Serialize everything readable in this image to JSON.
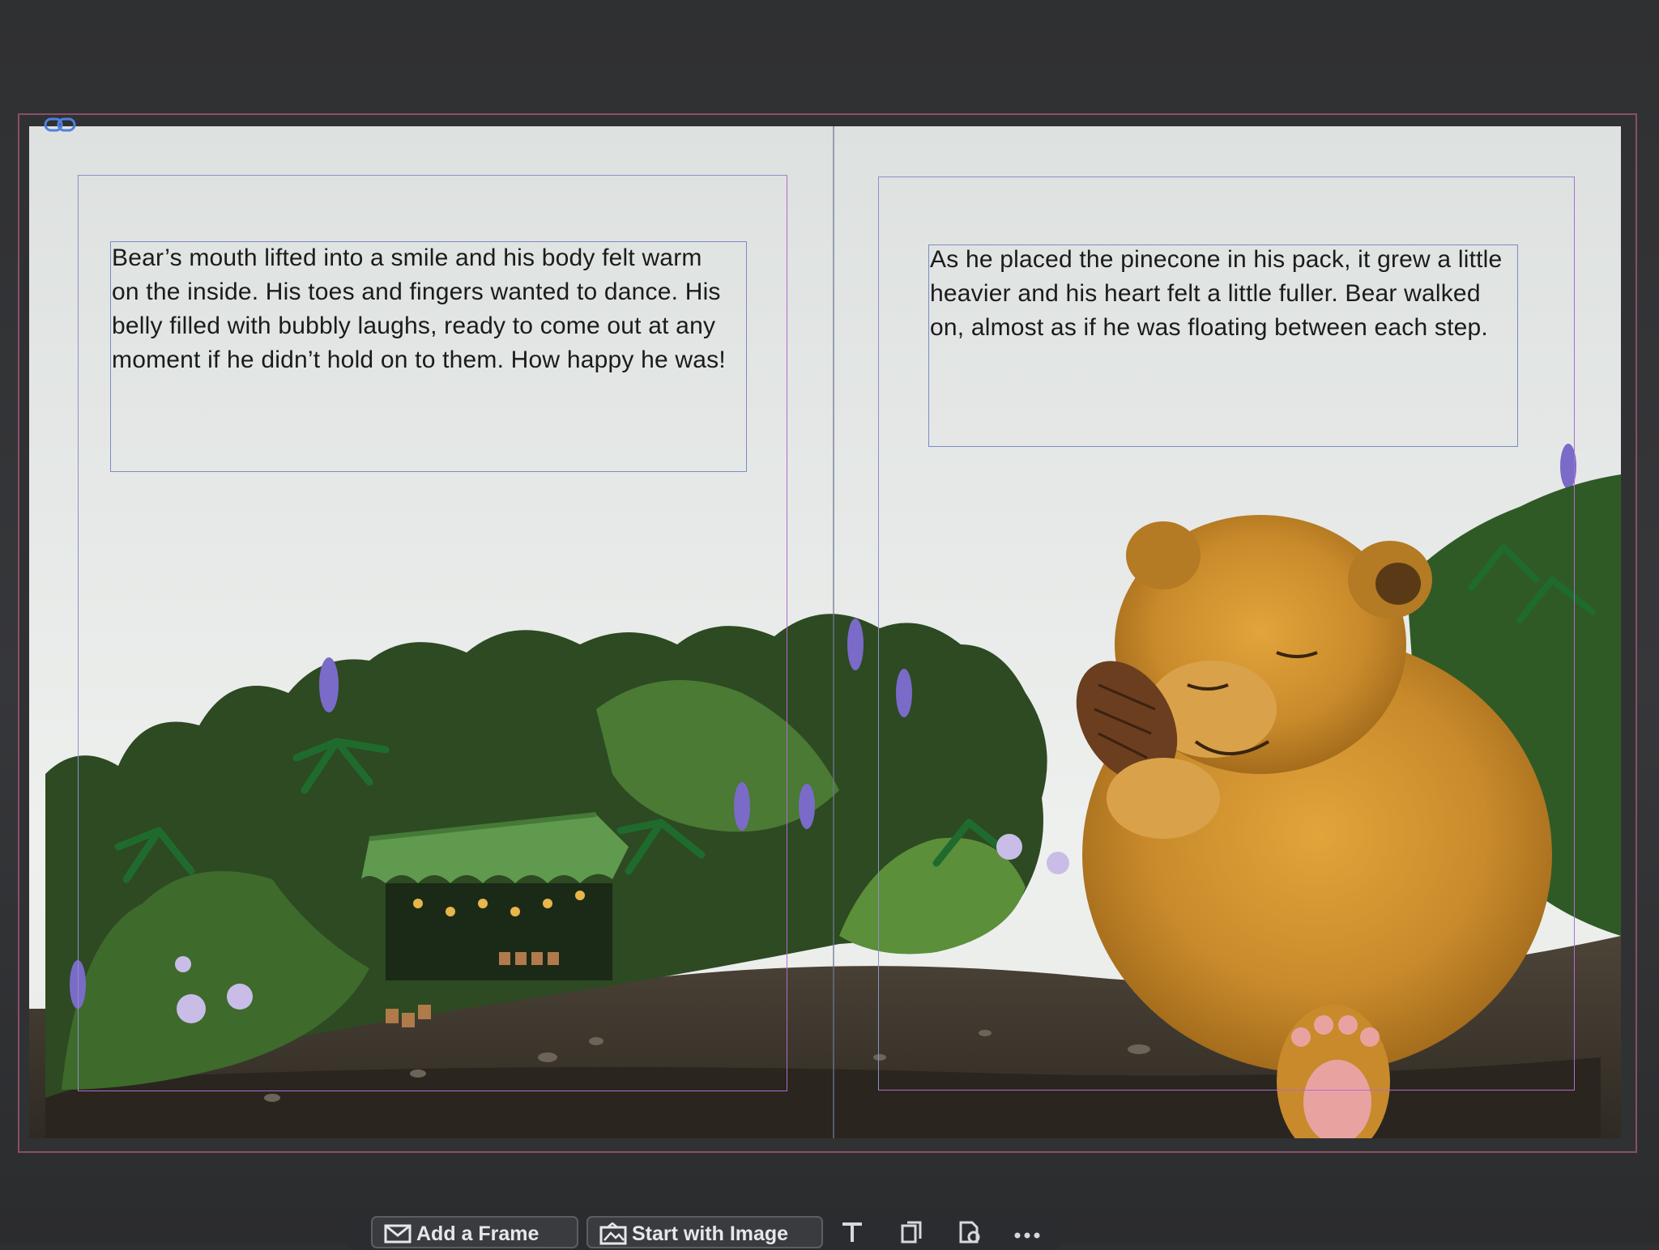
{
  "left_page": {
    "story_text": "Bear’s mouth lifted into a smile and his body felt warm on the inside. His toes and fingers wanted to dance. His belly filled with bubbly laughs, ready to come out at any moment if he didn’t hold on to them. How happy he was!"
  },
  "right_page": {
    "story_text": "As he placed the pinecone in his pack, it grew a little heavier and his heart felt a little fuller. Bear walked on, almost as if he was floating between each step."
  },
  "bottom_toolbar": {
    "add_frame_label": "Add a Frame",
    "start_with_image_label": "Start with Image",
    "icons": [
      "mail-frame-icon",
      "image-icon",
      "text-tool-icon",
      "pages-icon",
      "page-settings-icon",
      "more-icon"
    ]
  },
  "colors": {
    "bleed_guide": "#8a4f66",
    "margin_guide": "#b36ad0",
    "frame_border": "#7d8cc4"
  }
}
